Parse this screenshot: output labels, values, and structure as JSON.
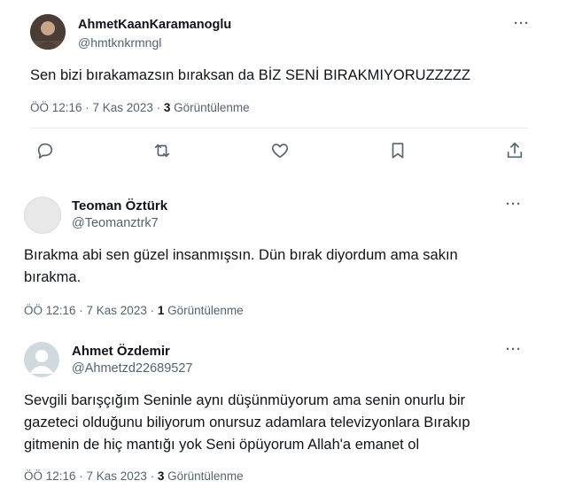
{
  "tweets": [
    {
      "name": "AhmetKaanKaramanoglu",
      "handle": "@hmtknkrmngl",
      "text": "Sen bizi bırakamazsın bıraksan da BİZ SENİ BIRAKMIYORUZZZZZ",
      "time": "ÖÖ 12:16 · 7 Kas 2023 · ",
      "views_count": "3",
      "views_label": " Görüntülenme",
      "avatar": "photo-avatar"
    },
    {
      "name": "Teoman Öztürk",
      "handle": "@Teomanztrk7",
      "text_line1": "Bırakma abi sen güzel insanmışsın. Dün bırak diyordum ama sakın",
      "text_line2": "bırakma.",
      "time": "ÖÖ 12:16 · 7 Kas 2023 · ",
      "views_count": "1",
      "views_label": " Görüntülenme",
      "avatar": "blank-avatar"
    },
    {
      "name": "Ahmet Özdemir",
      "handle": "@Ahmetzd22689527",
      "text_line1": "Sevgili barışçığım Seninle aynı düşünmüyorum ama senin onurlu bir",
      "text_line2": "gazeteci olduğunu biliyorum onursuz adamlara televizyonlara Bırakıp",
      "text_line3": "gitmenin de hiç mantığı yok Seni öpüyorum Allah'a emanet ol",
      "time": "ÖÖ 12:16 · 7 Kas 2023 · ",
      "views_count": "3",
      "views_label": " Görüntülenme",
      "avatar": "default-person-avatar"
    }
  ],
  "more_label": "···",
  "actions": [
    "reply-icon",
    "retweet-icon",
    "like-icon",
    "bookmark-icon",
    "share-icon"
  ]
}
